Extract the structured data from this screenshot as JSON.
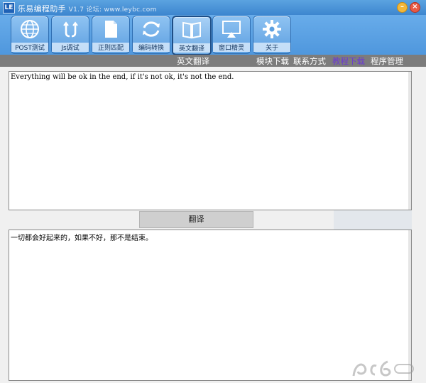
{
  "window": {
    "logo": "LE",
    "title": "乐易编程助手",
    "subtitle": "V1.7 论坛: www.leybc.com",
    "minimize_label": "–",
    "close_label": "×"
  },
  "toolbar": {
    "items": [
      {
        "label": "POST测试",
        "icon": "globe-icon"
      },
      {
        "label": "Js调试",
        "icon": "js-code-icon"
      },
      {
        "label": "正则匹配",
        "icon": "document-icon"
      },
      {
        "label": "编码转换",
        "icon": "refresh-icon"
      },
      {
        "label": "英文翻译",
        "icon": "book-icon"
      },
      {
        "label": "窗口精灵",
        "icon": "window-icon"
      },
      {
        "label": "关于",
        "icon": "gear-icon"
      }
    ],
    "active_index": 4
  },
  "menubar": {
    "tab_name": "英文翻译",
    "links": [
      "模块下载",
      "联系方式",
      "教程下载",
      "程序管理"
    ],
    "highlight_color": "#6c3ad2"
  },
  "translator": {
    "source_text": "Everything will be ok in the end, if it's not ok, it's not the end.",
    "button_label": "翻译",
    "result_text": "一切都会好起来的，如果不好，那不是结束。"
  }
}
